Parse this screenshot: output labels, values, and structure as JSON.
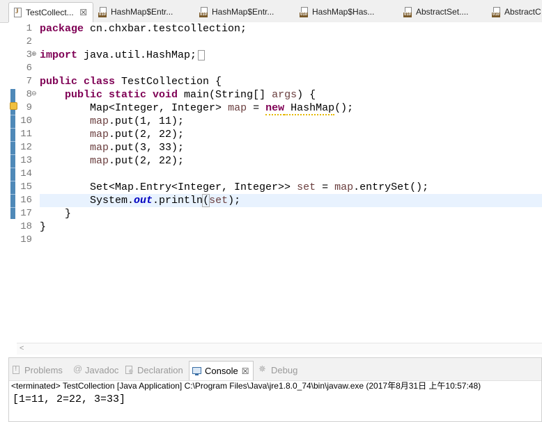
{
  "tabs": [
    {
      "label": "TestCollect...",
      "icon": "java-file-icon",
      "active": true
    },
    {
      "label": "HashMap$Entr...",
      "icon": "class-file-icon"
    },
    {
      "label": "HashMap$Entr...",
      "icon": "class-file-icon"
    },
    {
      "label": "HashMap$Has...",
      "icon": "class-file-icon"
    },
    {
      "label": "AbstractSet....",
      "icon": "class-file-icon"
    },
    {
      "label": "AbstractC",
      "icon": "class-file-icon"
    }
  ],
  "tab_close": "☒",
  "editor": {
    "line_numbers": [
      "1",
      "2",
      "3",
      "6",
      "7",
      "8",
      "9",
      "10",
      "11",
      "12",
      "13",
      "14",
      "15",
      "16",
      "17",
      "18",
      "19"
    ],
    "code": {
      "l1_kw": "package",
      "l1_rest": " cn.chxbar.testcollection;",
      "l3_kw": "import",
      "l3_rest": " java.util.HashMap;",
      "l7_kw": "public class",
      "l7_rest": " TestCollection {",
      "l8_kw": "public static void",
      "l8_rest": " main(String[] ",
      "l8_var": "args",
      "l8_end": ") {",
      "l9_a": "Map<Integer, Integer> ",
      "l9_var": "map",
      "l9_b": " = ",
      "l9_kw": "new",
      "l9_squig": " HashMap",
      "l9_c": "();",
      "l10_var": "map",
      "l10_rest": ".put(1, 11);",
      "l11_var": "map",
      "l11_rest": ".put(2, 22);",
      "l12_var": "map",
      "l12_rest": ".put(3, 33);",
      "l13_var": "map",
      "l13_rest": ".put(2, 22);",
      "l15_a": "Set<Map.Entry<Integer, Integer>> ",
      "l15_var": "set",
      "l15_b": " = ",
      "l15_var2": "map",
      "l15_c": ".entrySet();",
      "l16_a": "System.",
      "l16_static": "out",
      "l16_b": ".println",
      "l16_paren": "(",
      "l16_var": "set",
      "l16_c": ");",
      "l17": "}",
      "l18": "}"
    },
    "scroll_left_arrow": "<"
  },
  "panel": {
    "tabs": [
      {
        "label": "Problems",
        "icon": "problems-icon"
      },
      {
        "label": "Javadoc",
        "icon": "javadoc-icon"
      },
      {
        "label": "Declaration",
        "icon": "declaration-icon"
      },
      {
        "label": "Console",
        "icon": "console-icon",
        "active": true
      },
      {
        "label": "Debug",
        "icon": "debug-icon"
      }
    ],
    "close": "☒",
    "status": "<terminated> TestCollection [Java Application] C:\\Program Files\\Java\\jre1.8.0_74\\bin\\javaw.exe (2017年8月31日 上午10:57:48)",
    "output": "[1=11, 2=22, 3=33]"
  }
}
